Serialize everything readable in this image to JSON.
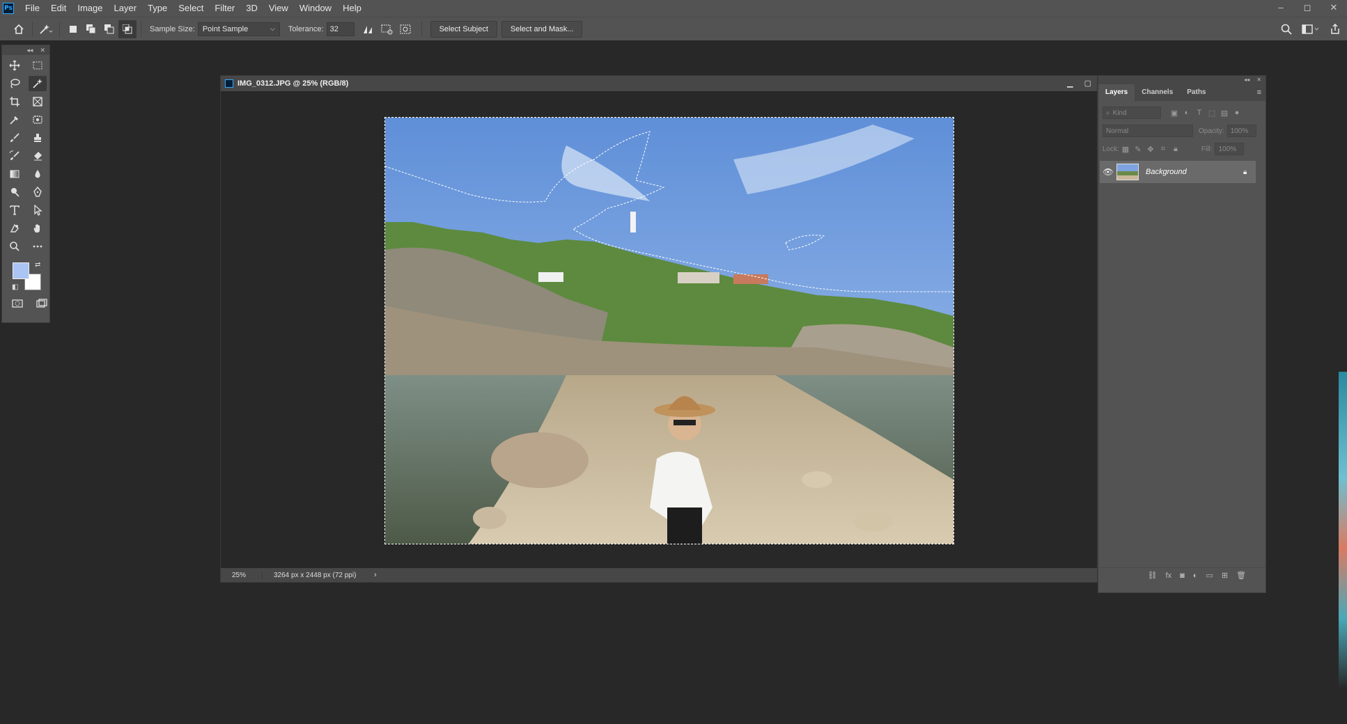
{
  "app": {
    "logo_text": "Ps",
    "menu": [
      "File",
      "Edit",
      "Image",
      "Layer",
      "Type",
      "Select",
      "Filter",
      "3D",
      "View",
      "Window",
      "Help"
    ],
    "window_controls": [
      "–",
      "◻",
      "✕"
    ]
  },
  "options_bar": {
    "sample_size_label": "Sample Size:",
    "sample_size_value": "Point Sample",
    "tolerance_label": "Tolerance:",
    "tolerance_value": "32",
    "select_subject_label": "Select Subject",
    "select_and_mask_label": "Select and Mask..."
  },
  "toolbox": {
    "foreground_color": "#aac4f4",
    "background_color": "#ffffff",
    "tools": [
      "move-tool",
      "marquee-tool",
      "lasso-tool",
      "magic-wand-tool",
      "crop-tool",
      "frame-tool",
      "eyedropper-tool",
      "patch-tool",
      "brush-tool",
      "stamp-tool",
      "history-brush-tool",
      "eraser-tool",
      "gradient-tool",
      "blur-tool",
      "dodge-tool",
      "pen-tool",
      "type-tool",
      "path-select-tool",
      "shape-tool",
      "hand-tool",
      "zoom-tool",
      "more-tools",
      "quick-mask-tool",
      "screen-mode-tool"
    ],
    "active_tool": "magic-wand-tool"
  },
  "document": {
    "title": "IMG_0312.JPG @ 25% (RGB/8)",
    "zoom": "25%",
    "info": "3264 px x 2448 px (72 ppi)"
  },
  "layers_panel": {
    "tabs": [
      "Layers",
      "Channels",
      "Paths"
    ],
    "active_tab": "Layers",
    "kind_placeholder": "Kind",
    "blend_mode": "Normal",
    "opacity_label": "Opacity:",
    "opacity_value": "100%",
    "lock_label": "Lock:",
    "fill_label": "Fill:",
    "fill_value": "100%",
    "layers": [
      {
        "name": "Background",
        "visible": true,
        "locked": true
      }
    ]
  }
}
